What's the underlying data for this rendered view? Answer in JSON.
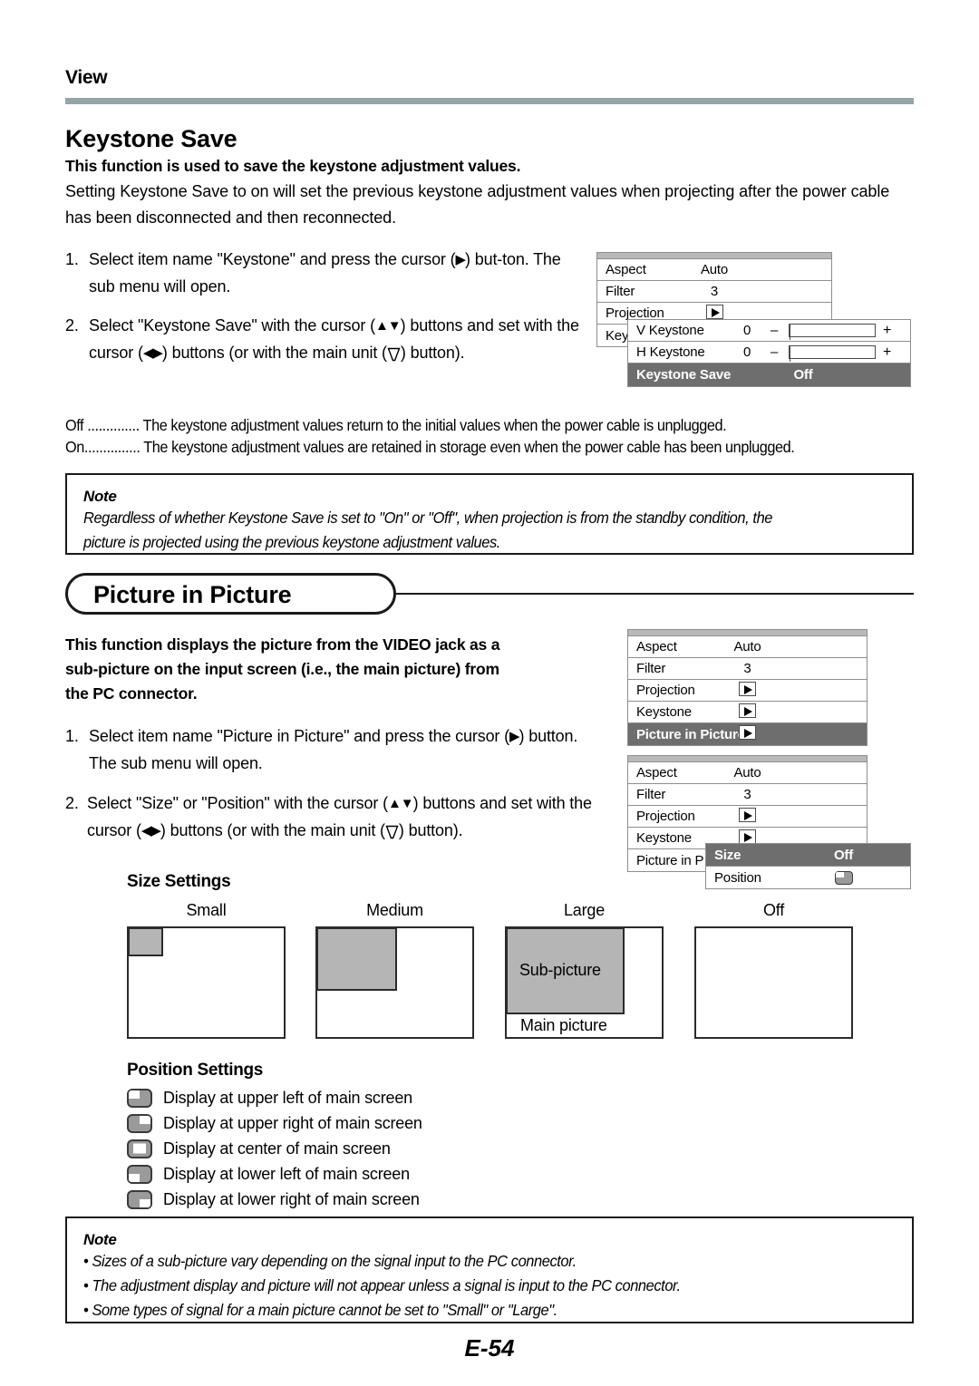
{
  "header": {
    "running_head": "View"
  },
  "keystone_save": {
    "title": "Keystone Save",
    "lead": "This function is used to save the keystone adjustment values.",
    "body": "Setting Keystone Save to on will set the previous keystone adjustment values when projecting after the power cable has been disconnected and then reconnected.",
    "steps": [
      {
        "num": "1.",
        "part1": "Select item name \"Keystone\" and press the cursor (",
        "glyph1": "▶",
        "part2": ") but-ton. The sub menu will open."
      },
      {
        "num": "2.",
        "part1": "Select \"Keystone Save\" with the cursor (",
        "glyph1": "▲▼",
        "part2": ") buttons and set with the cursor (",
        "glyph2": "◀▶",
        "part3": ") buttons (or with the main unit (",
        "part4": ") button)."
      }
    ],
    "definitions": [
      {
        "term": "Off",
        "dots": "..............",
        "desc": "The keystone adjustment values return to the initial values when the power cable is unplugged."
      },
      {
        "term": "On",
        "dots": "...............",
        "desc": "The keystone adjustment values are retained in storage even when the power cable has been unplugged."
      }
    ],
    "note": {
      "label": "Note",
      "lines": [
        "Regardless of whether Keystone Save is set to \"On\" or \"Off\", when projection is from the standby condition, the",
        "picture is projected using the previous keystone adjustment values."
      ]
    }
  },
  "osd_keystone": {
    "base_rows": [
      {
        "label": "Aspect",
        "value": "Auto",
        "type": "text"
      },
      {
        "label": "Filter",
        "value": "3",
        "type": "text"
      },
      {
        "label": "Projection",
        "value": "",
        "type": "arrow"
      },
      {
        "label": "Key",
        "value": "",
        "type": "text"
      }
    ],
    "sub_rows": [
      {
        "label": "V Keystone",
        "value": "0",
        "minus": "–",
        "plus": "+",
        "fill_pct": 52,
        "type": "slider"
      },
      {
        "label": "H Keystone",
        "value": "0",
        "minus": "–",
        "plus": "+",
        "fill_pct": 52,
        "type": "slider"
      },
      {
        "label": "Keystone Save",
        "value": "Off",
        "type": "selected"
      }
    ]
  },
  "picture_in_picture": {
    "title": "Picture in Picture",
    "lead_lines": [
      "This function displays the picture from the VIDEO jack as a",
      "sub-picture on the input screen (i.e., the main picture) from",
      "the PC connector."
    ],
    "steps": [
      {
        "num": "1.",
        "part1": "Select item name \"Picture in Picture\" and press the cursor (",
        "glyph1": "▶",
        "part2": ") button. The sub menu will open."
      },
      {
        "num": "2.",
        "part1": "Select \"Size\" or \"Position\" with the cursor (",
        "glyph1": "▲▼",
        "part2": ") buttons and set with the cursor (",
        "glyph2": "◀▶",
        "part3": ") buttons (or with the main unit (",
        "part4": ") button)."
      }
    ],
    "note": {
      "label": "Note",
      "bullets": [
        "Sizes of a sub-picture vary depending on the signal input to the PC connector.",
        "The adjustment display and picture will not appear unless a signal is input to the PC connector.",
        "Some types of signal for a main picture cannot be set to \"Small\" or \"Large\"."
      ]
    }
  },
  "osd_pip_main": {
    "rows": [
      {
        "label": "Aspect",
        "value": "Auto",
        "type": "text"
      },
      {
        "label": "Filter",
        "value": "3",
        "type": "text"
      },
      {
        "label": "Projection",
        "value": "",
        "type": "arrow"
      },
      {
        "label": "Keystone",
        "value": "",
        "type": "arrow"
      },
      {
        "label": "Picture in Picture",
        "value": "",
        "type": "arrow-selected"
      }
    ]
  },
  "osd_pip_sub": {
    "rows": [
      {
        "label": "Aspect",
        "value": "Auto",
        "type": "text"
      },
      {
        "label": "Filter",
        "value": "3",
        "type": "text"
      },
      {
        "label": "Projection",
        "value": "",
        "type": "arrow"
      },
      {
        "label": "Keystone",
        "value": "",
        "type": "arrow"
      },
      {
        "label": "Picture in P",
        "value": "",
        "type": "text"
      }
    ],
    "popup_rows": [
      {
        "label": "Size",
        "value": "Off",
        "type": "selected"
      },
      {
        "label": "Position",
        "value": "",
        "type": "posicon"
      }
    ]
  },
  "size_settings": {
    "heading": "Size Settings",
    "labels": [
      "Small",
      "Medium",
      "Large",
      "Off"
    ],
    "sub_picture_label": "Sub-picture",
    "main_picture_label": "Main picture"
  },
  "position_settings": {
    "heading": "Position Settings",
    "items": [
      {
        "icon": "position-upper-left-icon",
        "label": "Display at upper left of main screen"
      },
      {
        "icon": "position-upper-right-icon",
        "label": "Display at upper right of main screen"
      },
      {
        "icon": "position-center-icon",
        "label": "Display at center of main screen"
      },
      {
        "icon": "position-lower-left-icon",
        "label": "Display at lower left of main screen"
      },
      {
        "icon": "position-lower-right-icon",
        "label": "Display at lower right of main screen"
      }
    ]
  },
  "footer": {
    "page_number": "E-54"
  }
}
